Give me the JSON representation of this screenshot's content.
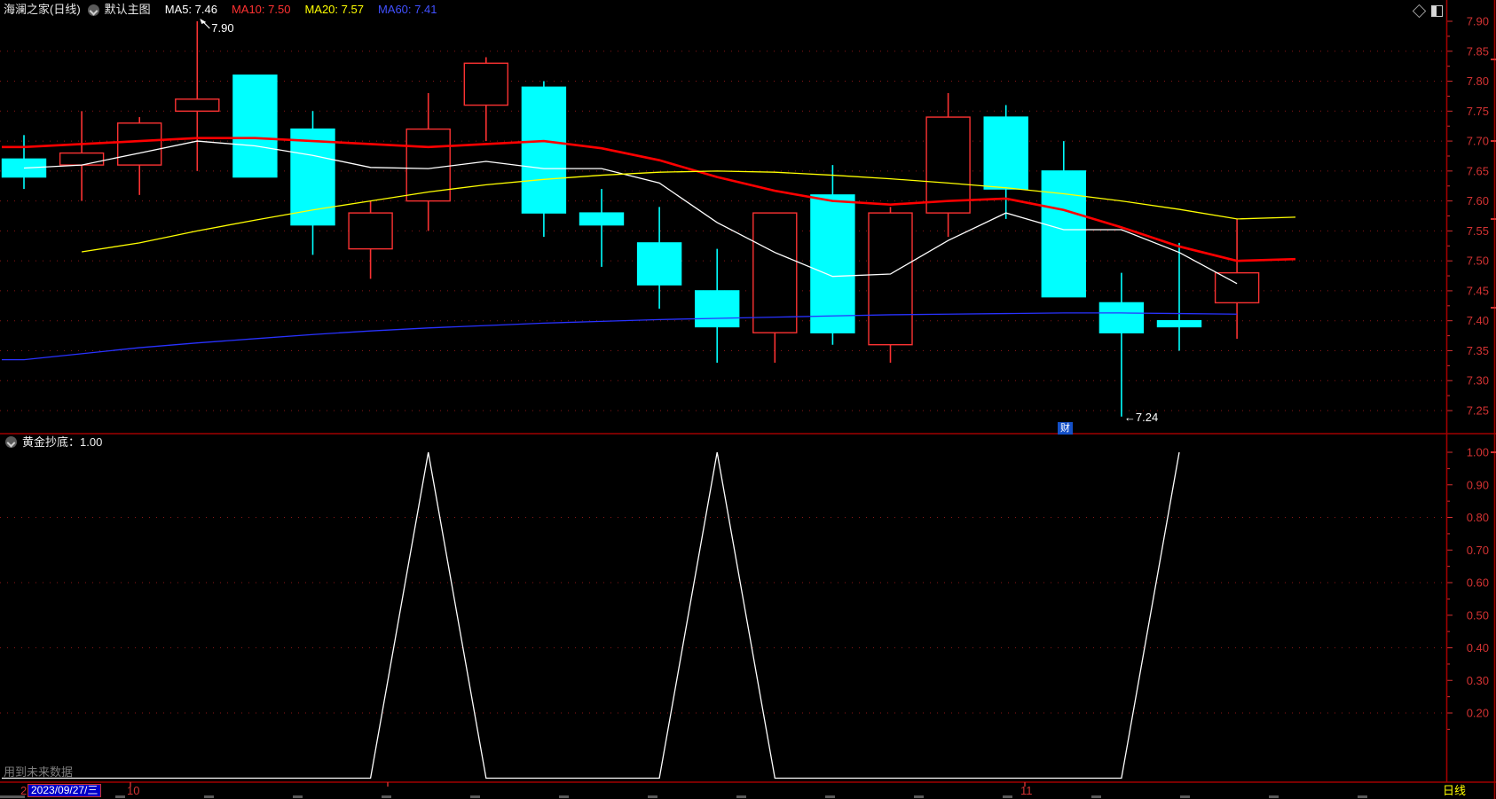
{
  "window": {
    "title": "海澜之家(日线)",
    "overlay_label": "默认主图",
    "ma_labels": [
      {
        "text": "MA5: 7.46",
        "color": "#ffffff"
      },
      {
        "text": "MA10: 7.50",
        "color": "#ff3232"
      },
      {
        "text": "MA20: 7.57",
        "color": "#ffff00"
      },
      {
        "text": "MA60: 7.41",
        "color": "#4150ff"
      }
    ]
  },
  "panel1": {
    "link_badge": "财"
  },
  "panel2": {
    "header": "黄金抄底：1.00"
  },
  "bottom": {
    "warning": "用到未来数据",
    "left_partial": "2",
    "date": "2023/09/27/三",
    "month_left": "10",
    "month_right": "11",
    "period": "日线"
  },
  "colors": {
    "up": "#fa3232",
    "down": "#00ffff",
    "axis_text": "#d23232",
    "grid": "#8a1616",
    "frame": "#a00000",
    "indicator_line": "#ffffff",
    "date_chip_bg": "#0000c8",
    "badge_bg": "#1450c8"
  },
  "chart_data": [
    {
      "type": "candlestick",
      "title": "海澜之家(日线)",
      "ylim": [
        7.22,
        7.92
      ],
      "y_tick_labels": [
        "7.90",
        "7.85",
        "7.80",
        "7.75",
        "7.70",
        "7.65",
        "7.60",
        "7.55",
        "7.50",
        "7.45",
        "7.40",
        "7.35",
        "7.30",
        "7.25"
      ],
      "grid": "dotted",
      "x_count": 22,
      "ohlc": [
        [
          7.67,
          7.71,
          7.62,
          7.64
        ],
        [
          7.66,
          7.75,
          7.6,
          7.68
        ],
        [
          7.66,
          7.74,
          7.61,
          7.73
        ],
        [
          7.75,
          7.9,
          7.65,
          7.77
        ],
        [
          7.81,
          7.81,
          7.64,
          7.64
        ],
        [
          7.72,
          7.75,
          7.51,
          7.56
        ],
        [
          7.52,
          7.6,
          7.47,
          7.58
        ],
        [
          7.6,
          7.78,
          7.55,
          7.72
        ],
        [
          7.76,
          7.84,
          7.7,
          7.83
        ],
        [
          7.79,
          7.8,
          7.54,
          7.58
        ],
        [
          7.58,
          7.62,
          7.49,
          7.56
        ],
        [
          7.53,
          7.59,
          7.42,
          7.46
        ],
        [
          7.45,
          7.52,
          7.33,
          7.39
        ],
        [
          7.38,
          7.58,
          7.33,
          7.58
        ],
        [
          7.61,
          7.66,
          7.36,
          7.38
        ],
        [
          7.36,
          7.59,
          7.33,
          7.58
        ],
        [
          7.58,
          7.78,
          7.54,
          7.74
        ],
        [
          7.74,
          7.76,
          7.57,
          7.62
        ],
        [
          7.65,
          7.7,
          7.44,
          7.44
        ],
        [
          7.43,
          7.48,
          7.24,
          7.38
        ],
        [
          7.4,
          7.53,
          7.35,
          7.39
        ],
        [
          7.43,
          7.57,
          7.37,
          7.48
        ]
      ],
      "series": [
        {
          "name": "MA5",
          "color": "#ffffff",
          "extend_left": false,
          "extend_right": false,
          "values": [
            7.655,
            7.66,
            7.68,
            7.7,
            7.692,
            7.676,
            7.656,
            7.654,
            7.666,
            7.654,
            7.654,
            7.63,
            7.564,
            7.514,
            7.474,
            7.478,
            7.534,
            7.58,
            7.552,
            7.552,
            7.514,
            7.462
          ]
        },
        {
          "name": "MA10",
          "color": "#ff0000",
          "extend_left": true,
          "extend_right": true,
          "values": [
            7.69,
            7.695,
            7.7,
            7.705,
            7.705,
            7.7,
            7.695,
            7.69,
            7.695,
            7.7,
            7.688,
            7.668,
            7.64,
            7.617,
            7.6,
            7.594,
            7.6,
            7.604,
            7.585,
            7.556,
            7.524,
            7.5
          ]
        },
        {
          "name": "MA20",
          "color": "#ffff00",
          "extend_left": false,
          "extend_right": true,
          "values": [
            null,
            7.515,
            7.53,
            7.55,
            7.568,
            7.585,
            7.6,
            7.615,
            7.627,
            7.636,
            7.643,
            7.648,
            7.65,
            7.648,
            7.643,
            7.637,
            7.63,
            7.622,
            7.612,
            7.6,
            7.586,
            7.57
          ]
        },
        {
          "name": "MA60",
          "color": "#2832ff",
          "extend_left": true,
          "extend_right": false,
          "values": [
            7.335,
            7.345,
            7.355,
            7.363,
            7.37,
            7.377,
            7.383,
            7.388,
            7.392,
            7.396,
            7.399,
            7.402,
            7.404,
            7.406,
            7.408,
            7.41,
            7.411,
            7.412,
            7.413,
            7.413,
            7.412,
            7.411
          ]
        }
      ],
      "annotations": [
        {
          "text": "7.90",
          "bar": 3,
          "price": 7.9,
          "dir": "high"
        },
        {
          "text": "←7.24",
          "bar": 19,
          "price": 7.24,
          "dir": "low"
        }
      ]
    },
    {
      "type": "line",
      "name": "黄金抄底",
      "current_value": "1.00",
      "ylim": [
        0,
        1.06
      ],
      "y_tick_labels": [
        "1.00",
        "0.90",
        "0.80",
        "0.70",
        "0.60",
        "0.50",
        "0.40",
        "0.30",
        "0.20"
      ],
      "grid_at": [
        0.8,
        0.6,
        0.4,
        0.2
      ],
      "color": "#ffffff",
      "values": [
        0,
        0,
        0,
        0,
        0,
        0,
        0,
        1,
        0,
        0,
        0,
        0,
        1,
        0,
        0,
        0,
        0,
        0,
        0,
        0,
        1,
        null
      ]
    }
  ]
}
